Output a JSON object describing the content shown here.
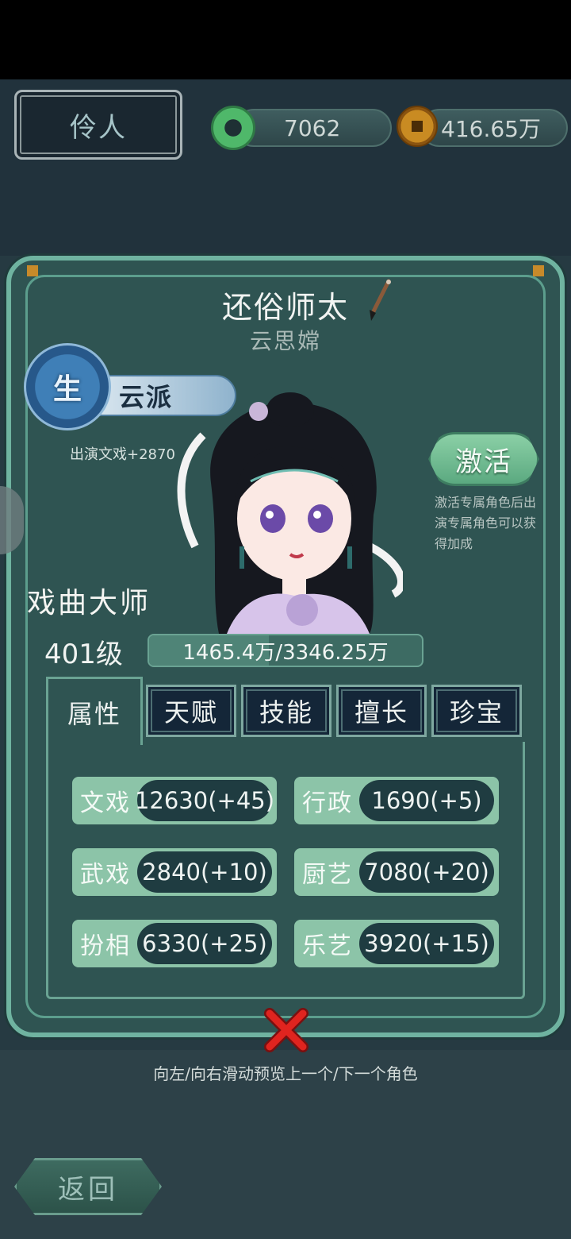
{
  "header": {
    "tab_label": "伶人",
    "jade_amount": "7062",
    "coin_amount": "416.65万"
  },
  "character": {
    "name": "还俗师太",
    "person": "云思嫦",
    "faction_badge": "生",
    "faction": "云派",
    "perf_bonus": "出演文戏+2870",
    "rank_title": "戏曲大师",
    "level": "401级",
    "exp_text": "1465.4万/3346.25万",
    "exp_progress": 0.438
  },
  "activate": {
    "label": "激活",
    "description": "激活专属角色后出演专属角色可以获得加成"
  },
  "tabs": [
    {
      "label": "属性",
      "active": true
    },
    {
      "label": "天赋",
      "active": false
    },
    {
      "label": "技能",
      "active": false
    },
    {
      "label": "擅长",
      "active": false
    },
    {
      "label": "珍宝",
      "active": false
    }
  ],
  "attributes": [
    {
      "label": "文戏",
      "value": "12630(+45)"
    },
    {
      "label": "行政",
      "value": "1690(+5)"
    },
    {
      "label": "武戏",
      "value": "2840(+10)"
    },
    {
      "label": "厨艺",
      "value": "7080(+20)"
    },
    {
      "label": "扮相",
      "value": "6330(+25)"
    },
    {
      "label": "乐艺",
      "value": "3920(+15)"
    }
  ],
  "hint": "向左/向右滑动预览上一个/下一个角色",
  "back_label": "返回",
  "icons": {
    "jade": "jade-disc-icon",
    "coin": "copper-coin-icon",
    "brush": "brush-icon",
    "close": "close-x-icon"
  }
}
